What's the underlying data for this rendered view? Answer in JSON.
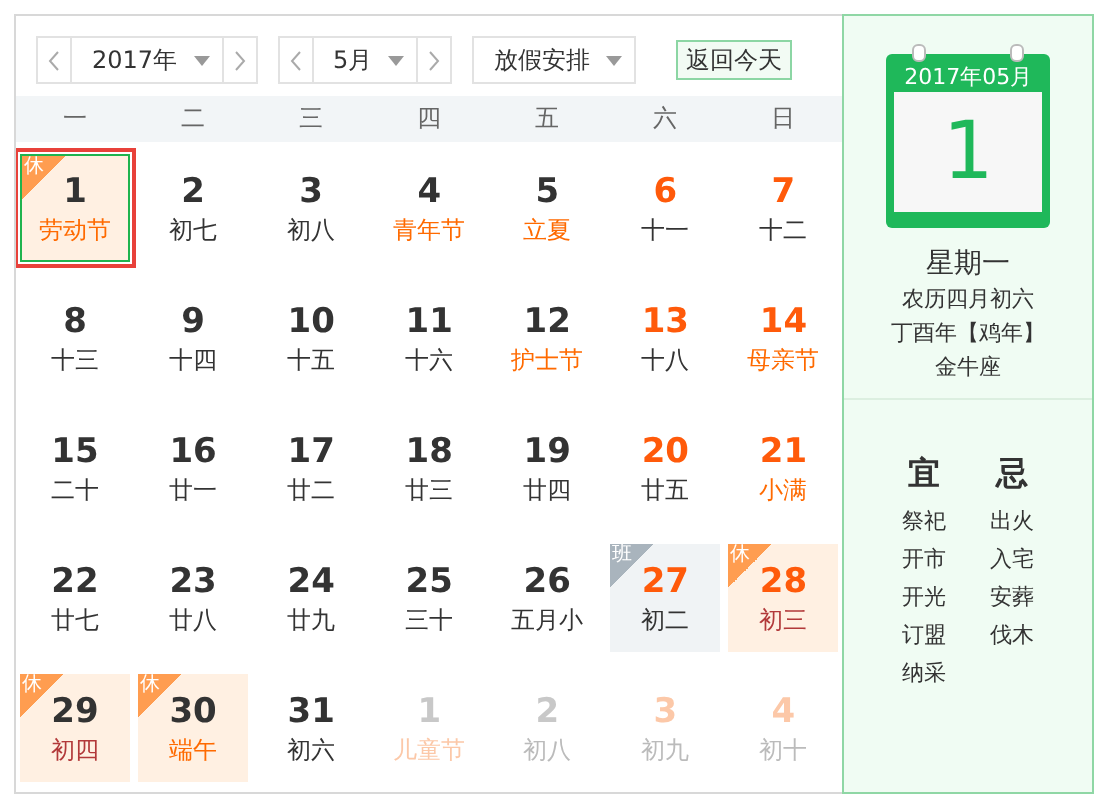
{
  "toolbar": {
    "year": {
      "value": "2017年"
    },
    "month": {
      "value": "5月"
    },
    "holiday_select": {
      "value": "放假安排"
    },
    "today_button": "返回今天"
  },
  "weekdays": [
    "一",
    "二",
    "三",
    "四",
    "五",
    "六",
    "日"
  ],
  "weeks": [
    [
      {
        "day": "1",
        "sub": "劳动节",
        "weekend": false,
        "festival": true,
        "badge": {
          "text": "休",
          "kind": "rest"
        },
        "other_month": false,
        "selected": true
      },
      {
        "day": "2",
        "sub": "初七",
        "weekend": false,
        "festival": false,
        "other_month": false,
        "selected": false
      },
      {
        "day": "3",
        "sub": "初八",
        "weekend": false,
        "festival": false,
        "other_month": false,
        "selected": false
      },
      {
        "day": "4",
        "sub": "青年节",
        "weekend": false,
        "festival": true,
        "other_month": false,
        "selected": false
      },
      {
        "day": "5",
        "sub": "立夏",
        "weekend": false,
        "festival": true,
        "other_month": false,
        "selected": false
      },
      {
        "day": "6",
        "sub": "十一",
        "weekend": true,
        "festival": false,
        "other_month": false,
        "selected": false
      },
      {
        "day": "7",
        "sub": "十二",
        "weekend": true,
        "festival": false,
        "other_month": false,
        "selected": false
      }
    ],
    [
      {
        "day": "8",
        "sub": "十三",
        "weekend": false,
        "festival": false,
        "other_month": false,
        "selected": false
      },
      {
        "day": "9",
        "sub": "十四",
        "weekend": false,
        "festival": false,
        "other_month": false,
        "selected": false
      },
      {
        "day": "10",
        "sub": "十五",
        "weekend": false,
        "festival": false,
        "other_month": false,
        "selected": false
      },
      {
        "day": "11",
        "sub": "十六",
        "weekend": false,
        "festival": false,
        "other_month": false,
        "selected": false
      },
      {
        "day": "12",
        "sub": "护士节",
        "weekend": false,
        "festival": true,
        "other_month": false,
        "selected": false
      },
      {
        "day": "13",
        "sub": "十八",
        "weekend": true,
        "festival": false,
        "other_month": false,
        "selected": false
      },
      {
        "day": "14",
        "sub": "母亲节",
        "weekend": true,
        "festival": true,
        "other_month": false,
        "selected": false
      }
    ],
    [
      {
        "day": "15",
        "sub": "二十",
        "weekend": false,
        "festival": false,
        "other_month": false,
        "selected": false
      },
      {
        "day": "16",
        "sub": "廿一",
        "weekend": false,
        "festival": false,
        "other_month": false,
        "selected": false
      },
      {
        "day": "17",
        "sub": "廿二",
        "weekend": false,
        "festival": false,
        "other_month": false,
        "selected": false
      },
      {
        "day": "18",
        "sub": "廿三",
        "weekend": false,
        "festival": false,
        "other_month": false,
        "selected": false
      },
      {
        "day": "19",
        "sub": "廿四",
        "weekend": false,
        "festival": false,
        "other_month": false,
        "selected": false
      },
      {
        "day": "20",
        "sub": "廿五",
        "weekend": true,
        "festival": false,
        "other_month": false,
        "selected": false
      },
      {
        "day": "21",
        "sub": "小满",
        "weekend": true,
        "festival": true,
        "other_month": false,
        "selected": false
      }
    ],
    [
      {
        "day": "22",
        "sub": "廿七",
        "weekend": false,
        "festival": false,
        "other_month": false,
        "selected": false
      },
      {
        "day": "23",
        "sub": "廿八",
        "weekend": false,
        "festival": false,
        "other_month": false,
        "selected": false
      },
      {
        "day": "24",
        "sub": "廿九",
        "weekend": false,
        "festival": false,
        "other_month": false,
        "selected": false
      },
      {
        "day": "25",
        "sub": "三十",
        "weekend": false,
        "festival": false,
        "other_month": false,
        "selected": false
      },
      {
        "day": "26",
        "sub": "五月小",
        "weekend": false,
        "festival": false,
        "other_month": false,
        "selected": false
      },
      {
        "day": "27",
        "sub": "初二",
        "weekend": true,
        "festival": false,
        "badge": {
          "text": "班",
          "kind": "work"
        },
        "other_month": false,
        "selected": false
      },
      {
        "day": "28",
        "sub": "初三",
        "weekend": true,
        "festival": false,
        "badge": {
          "text": "休",
          "kind": "rest"
        },
        "other_month": false,
        "selected": false
      }
    ],
    [
      {
        "day": "29",
        "sub": "初四",
        "weekend": false,
        "festival": false,
        "badge": {
          "text": "休",
          "kind": "rest"
        },
        "other_month": false,
        "selected": false
      },
      {
        "day": "30",
        "sub": "端午",
        "weekend": false,
        "festival": true,
        "badge": {
          "text": "休",
          "kind": "rest"
        },
        "other_month": false,
        "selected": false
      },
      {
        "day": "31",
        "sub": "初六",
        "weekend": false,
        "festival": false,
        "other_month": false,
        "selected": false
      },
      {
        "day": "1",
        "sub": "儿童节",
        "weekend": false,
        "festival": true,
        "other_month": true,
        "selected": false
      },
      {
        "day": "2",
        "sub": "初八",
        "weekend": false,
        "festival": false,
        "other_month": true,
        "selected": false
      },
      {
        "day": "3",
        "sub": "初九",
        "weekend": true,
        "festival": false,
        "other_month": true,
        "selected": false
      },
      {
        "day": "4",
        "sub": "初十",
        "weekend": true,
        "festival": false,
        "other_month": true,
        "selected": false
      }
    ]
  ],
  "detail": {
    "calendar_header": "2017年05月",
    "calendar_day": "1",
    "weekday": "星期一",
    "lunar": "农历四月初六",
    "ganzhi": "丁酉年【鸡年】",
    "zodiac": "金牛座",
    "suitable": {
      "title": "宜",
      "items": [
        "祭祀",
        "开市",
        "开光",
        "订盟",
        "纳采"
      ]
    },
    "avoid": {
      "title": "忌",
      "items": [
        "出火",
        "入宅",
        "安葬",
        "伐木"
      ]
    }
  }
}
